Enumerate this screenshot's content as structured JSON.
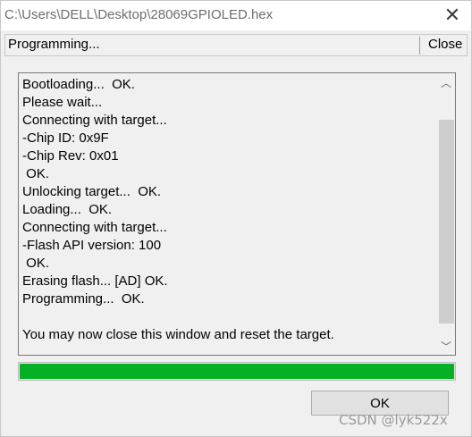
{
  "window": {
    "title": "C:\\Users\\DELL\\Desktop\\28069GPIOLED.hex",
    "close_glyph": "✕"
  },
  "status": {
    "text": "Programming...",
    "close_label": "Close"
  },
  "log": {
    "lines": [
      "Bootloading...  OK.",
      "Please wait...",
      "Connecting with target...",
      "-Chip ID: 0x9F",
      "-Chip Rev: 0x01",
      " OK.",
      "Unlocking target...  OK.",
      "Loading...  OK.",
      "Connecting with target...",
      "-Flash API version: 100",
      " OK.",
      "Erasing flash... [AD] OK.",
      "Programming...  OK.",
      "",
      "You may now close this window and reset the target."
    ],
    "scroll_up_glyph": "︿",
    "scroll_down_glyph": "﹀"
  },
  "progress": {
    "fraction": 1.0,
    "color": "#06b025"
  },
  "ok_button": {
    "label": "OK"
  },
  "watermark": {
    "text": "CSDN @lyk522x"
  }
}
